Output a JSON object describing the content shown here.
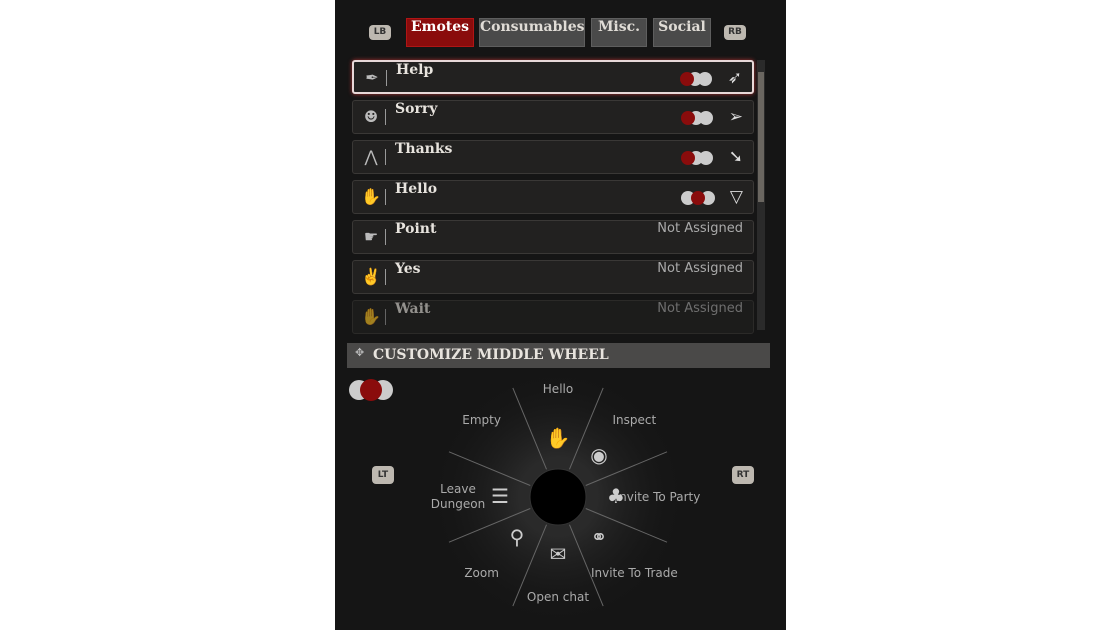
{
  "tabs": {
    "left_bumper": "LB",
    "right_bumper": "RB",
    "items": [
      {
        "label": "Emotes",
        "active": true
      },
      {
        "label": "Consumables"
      },
      {
        "label": "Misc."
      },
      {
        "label": "Social"
      }
    ]
  },
  "emotes": [
    {
      "label": "Help",
      "icon": "feather-icon",
      "assigned": true,
      "selected": true,
      "direction": "up-right"
    },
    {
      "label": "Sorry",
      "icon": "mask-icon",
      "assigned": true,
      "direction": "right"
    },
    {
      "label": "Thanks",
      "icon": "praying-hands-icon",
      "assigned": true,
      "direction": "down-right"
    },
    {
      "label": "Hello",
      "icon": "waving-hand-icon",
      "assigned": true,
      "wheel": "middle",
      "direction": "down"
    },
    {
      "label": "Point",
      "icon": "pointing-hand-icon",
      "status": "Not Assigned"
    },
    {
      "label": "Yes",
      "icon": "thumbs-up-icon",
      "status": "Not Assigned"
    },
    {
      "label": "Wait",
      "icon": "open-hand-icon",
      "status": "Not Assigned"
    }
  ],
  "wheel": {
    "title": "CUSTOMIZE MIDDLE WHEEL",
    "left_trigger": "LT",
    "right_trigger": "RT",
    "segments": [
      {
        "label": "Hello",
        "icon": "waving-hand-icon"
      },
      {
        "label": "Inspect",
        "icon": "eye-icon"
      },
      {
        "label": "Invite To Party",
        "icon": "party-icon"
      },
      {
        "label": "Invite To Trade",
        "icon": "handshake-icon"
      },
      {
        "label": "Open chat",
        "icon": "chat-bubble-icon"
      },
      {
        "label": "Zoom",
        "icon": "magnifier-icon"
      },
      {
        "label": "Leave Dungeon",
        "icon": "stairs-icon"
      },
      {
        "label": "Empty",
        "icon": ""
      }
    ]
  },
  "colors": {
    "accent": "#8a0c0c",
    "panel": "#151515"
  }
}
